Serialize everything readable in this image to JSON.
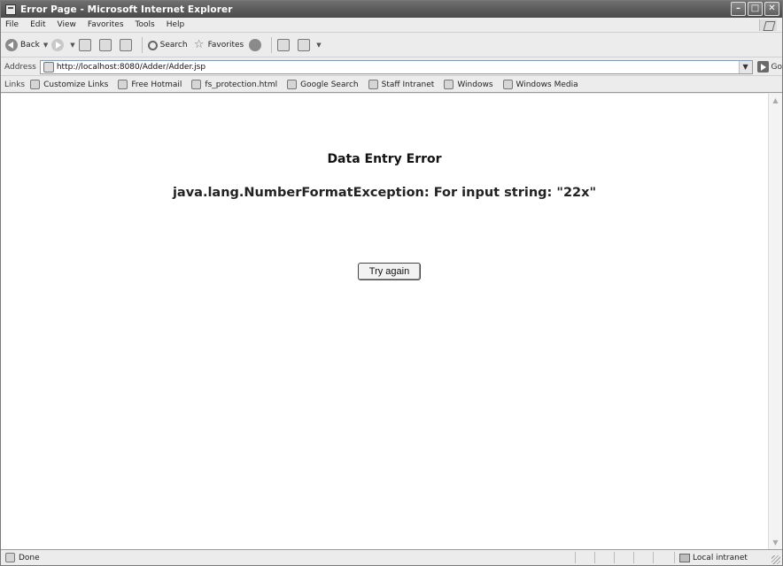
{
  "window": {
    "title": "Error Page - Microsoft Internet Explorer"
  },
  "menu": [
    "File",
    "Edit",
    "View",
    "Favorites",
    "Tools",
    "Help"
  ],
  "toolbar": {
    "back_label": "Back",
    "search_label": "Search",
    "favorites_label": "Favorites"
  },
  "address": {
    "label": "Address",
    "url": "http://localhost:8080/Adder/Adder.jsp",
    "go_label": "Go"
  },
  "links": {
    "label": "Links",
    "items": [
      "Customize Links",
      "Free Hotmail",
      "fs_protection.html",
      "Google Search",
      "Staff Intranet",
      "Windows",
      "Windows Media"
    ]
  },
  "content": {
    "heading": "Data Entry Error",
    "error_message": "java.lang.NumberFormatException: For input string: \"22x\"",
    "button_label": "Try again"
  },
  "status": {
    "text": "Done",
    "zone": "Local intranet"
  }
}
